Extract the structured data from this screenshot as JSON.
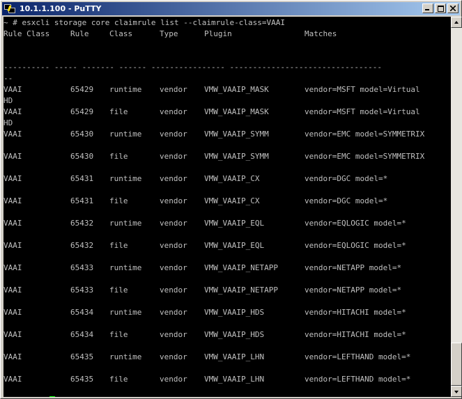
{
  "window": {
    "title": "10.1.1.100 - PuTTY"
  },
  "terminal": {
    "command_line": "~ # esxcli storage core claimrule list --claimrule-class=VAAI",
    "headers": [
      "Rule Class",
      "Rule",
      "Class",
      "Type",
      "Plugin",
      "Matches"
    ],
    "separator": "---------- ----- ------- ------ ---------------- ---------------------------------",
    "separator_wrap": "--",
    "rows": [
      {
        "rule_class": "VAAI",
        "rule": "65429",
        "class": "runtime",
        "type": "vendor",
        "plugin": "VMW_VAAIP_MASK",
        "matches": "vendor=MSFT model=Virtual",
        "wrap": "HD"
      },
      {
        "rule_class": "VAAI",
        "rule": "65429",
        "class": "file",
        "type": "vendor",
        "plugin": "VMW_VAAIP_MASK",
        "matches": "vendor=MSFT model=Virtual",
        "wrap": "HD"
      },
      {
        "rule_class": "VAAI",
        "rule": "65430",
        "class": "runtime",
        "type": "vendor",
        "plugin": "VMW_VAAIP_SYMM",
        "matches": "vendor=EMC model=SYMMETRIX",
        "wrap": ""
      },
      {
        "rule_class": "VAAI",
        "rule": "65430",
        "class": "file",
        "type": "vendor",
        "plugin": "VMW_VAAIP_SYMM",
        "matches": "vendor=EMC model=SYMMETRIX",
        "wrap": ""
      },
      {
        "rule_class": "VAAI",
        "rule": "65431",
        "class": "runtime",
        "type": "vendor",
        "plugin": "VMW_VAAIP_CX",
        "matches": "vendor=DGC model=*",
        "wrap": ""
      },
      {
        "rule_class": "VAAI",
        "rule": "65431",
        "class": "file",
        "type": "vendor",
        "plugin": "VMW_VAAIP_CX",
        "matches": "vendor=DGC model=*",
        "wrap": ""
      },
      {
        "rule_class": "VAAI",
        "rule": "65432",
        "class": "runtime",
        "type": "vendor",
        "plugin": "VMW_VAAIP_EQL",
        "matches": "vendor=EQLOGIC model=*",
        "wrap": ""
      },
      {
        "rule_class": "VAAI",
        "rule": "65432",
        "class": "file",
        "type": "vendor",
        "plugin": "VMW_VAAIP_EQL",
        "matches": "vendor=EQLOGIC model=*",
        "wrap": ""
      },
      {
        "rule_class": "VAAI",
        "rule": "65433",
        "class": "runtime",
        "type": "vendor",
        "plugin": "VMW_VAAIP_NETAPP",
        "matches": "vendor=NETAPP model=*",
        "wrap": ""
      },
      {
        "rule_class": "VAAI",
        "rule": "65433",
        "class": "file",
        "type": "vendor",
        "plugin": "VMW_VAAIP_NETAPP",
        "matches": "vendor=NETAPP model=*",
        "wrap": ""
      },
      {
        "rule_class": "VAAI",
        "rule": "65434",
        "class": "runtime",
        "type": "vendor",
        "plugin": "VMW_VAAIP_HDS",
        "matches": "vendor=HITACHI model=*",
        "wrap": ""
      },
      {
        "rule_class": "VAAI",
        "rule": "65434",
        "class": "file",
        "type": "vendor",
        "plugin": "VMW_VAAIP_HDS",
        "matches": "vendor=HITACHI model=*",
        "wrap": ""
      },
      {
        "rule_class": "VAAI",
        "rule": "65435",
        "class": "runtime",
        "type": "vendor",
        "plugin": "VMW_VAAIP_LHN",
        "matches": "vendor=LEFTHAND model=*",
        "wrap": ""
      },
      {
        "rule_class": "VAAI",
        "rule": "65435",
        "class": "file",
        "type": "vendor",
        "plugin": "VMW_VAAIP_LHN",
        "matches": "vendor=LEFTHAND model=*",
        "wrap": ""
      }
    ],
    "prompt": "~ #",
    "colors": {
      "background": "#000000",
      "foreground": "#c0c0c0",
      "cursor": "#00ff00",
      "titlebar_start": "#0a246a",
      "titlebar_end": "#a6caf0"
    }
  },
  "scrollbar": {
    "position_fraction": 1.0
  }
}
